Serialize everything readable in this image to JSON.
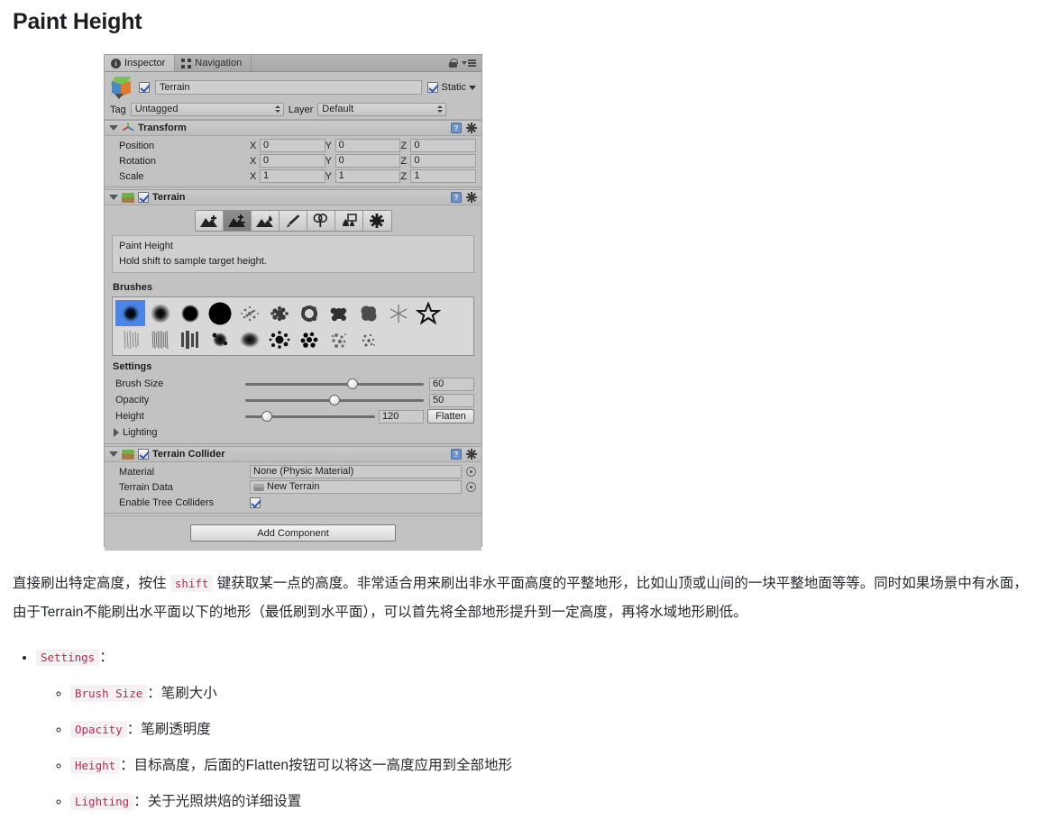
{
  "page": {
    "title": "Paint Height"
  },
  "inspector": {
    "tabs": [
      {
        "label": "Inspector",
        "icon": "info-icon",
        "active": true
      },
      {
        "label": "Navigation",
        "icon": "navigation-icon",
        "active": false
      }
    ],
    "header_icons": {
      "lock": "lock-icon",
      "menu": "menu-icon"
    },
    "object": {
      "enabled_checkbox": true,
      "name": "Terrain",
      "static_label": "Static",
      "static_checked": true,
      "tag_label": "Tag",
      "tag_value": "Untagged",
      "layer_label": "Layer",
      "layer_value": "Default"
    },
    "transform": {
      "title": "Transform",
      "rows": [
        {
          "label": "Position",
          "x": "0",
          "y": "0",
          "z": "0"
        },
        {
          "label": "Rotation",
          "x": "0",
          "y": "0",
          "z": "0"
        },
        {
          "label": "Scale",
          "x": "1",
          "y": "1",
          "z": "1"
        }
      ],
      "axes": {
        "x": "X",
        "y": "Y",
        "z": "Z"
      }
    },
    "terrain": {
      "title": "Terrain",
      "enabled": true,
      "tools": [
        {
          "name": "raise-lower-terrain",
          "selected": false
        },
        {
          "name": "paint-height",
          "selected": true
        },
        {
          "name": "smooth-height",
          "selected": false
        },
        {
          "name": "paint-texture",
          "selected": false
        },
        {
          "name": "place-trees",
          "selected": false
        },
        {
          "name": "paint-details",
          "selected": false
        },
        {
          "name": "terrain-settings",
          "selected": false
        }
      ],
      "info_title": "Paint Height",
      "info_text": "Hold shift to sample target height.",
      "brushes_label": "Brushes",
      "brushes_selected_index": 0,
      "brushes_count": 20,
      "settings_label": "Settings",
      "settings": [
        {
          "label": "Brush Size",
          "value": "60",
          "percent": 60
        },
        {
          "label": "Opacity",
          "value": "50",
          "percent": 50
        },
        {
          "label": "Height",
          "value": "120",
          "percent": 17
        }
      ],
      "flatten_label": "Flatten",
      "lighting_label": "Lighting"
    },
    "terrain_collider": {
      "title": "Terrain Collider",
      "enabled": true,
      "material_label": "Material",
      "material_value": "None (Physic Material)",
      "terrain_data_label": "Terrain Data",
      "terrain_data_value": "New Terrain",
      "enable_tree_colliders_label": "Enable Tree Colliders",
      "enable_tree_colliders_checked": true
    },
    "add_component_label": "Add Component"
  },
  "prose": {
    "paragraph_part1": "直接刷出特定高度，按住 ",
    "paragraph_code": "shift",
    "paragraph_part2": " 键获取某一点的高度。非常适合用来刷出非水平面高度的平整地形，比如山顶或山间的一块平整地面等等。同时如果场景中有水面，由于Terrain不能刷出水平面以下的地形（最低刷到水平面），可以首先将全部地形提升到一定高度，再将水域地形刷低。",
    "bullet_settings_code": "Settings",
    "bullet_settings_colon": "：",
    "items": [
      {
        "code": "Brush Size",
        "text": "：笔刷大小"
      },
      {
        "code": "Opacity",
        "text": "：笔刷透明度"
      },
      {
        "code": "Height",
        "text": "：目标高度，后面的Flatten按钮可以将这一高度应用到全部地形"
      },
      {
        "code": "Lighting",
        "text": "：关于光照烘焙的详细设置"
      }
    ]
  }
}
